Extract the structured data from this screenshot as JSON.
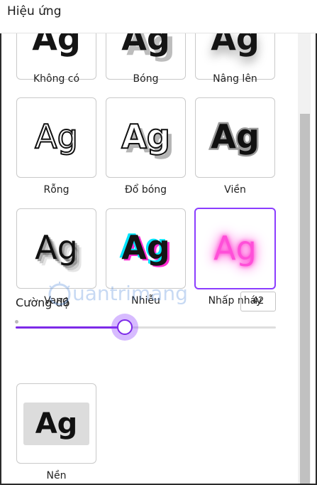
{
  "header": {
    "title": "Hiệu ứng"
  },
  "effects": [
    {
      "sample": "Ag",
      "label": "Không có"
    },
    {
      "sample": "Ag",
      "label": "Bóng"
    },
    {
      "sample": "Ag",
      "label": "Nâng lên"
    },
    {
      "sample": "Ag",
      "label": "Rỗng"
    },
    {
      "sample": "Ag",
      "label": "Đổ bóng"
    },
    {
      "sample": "Ag",
      "label": "Viền"
    },
    {
      "sample": "Ag",
      "label": "Vang"
    },
    {
      "sample": "Ag",
      "label": "Nhiễu"
    },
    {
      "sample": "Ag",
      "label": "Nhấp nháy"
    },
    {
      "sample": "Ag",
      "label": "Nền"
    }
  ],
  "selected_effect": "Nhấp nháy",
  "intensity": {
    "label": "Cường độ",
    "value": "42",
    "fraction": 0.42
  },
  "watermark": {
    "text": "uantrimang"
  },
  "colors": {
    "accent": "#8b3dff",
    "neon": "#ff3dd2",
    "glitch_cyan": "#00e5ff"
  }
}
